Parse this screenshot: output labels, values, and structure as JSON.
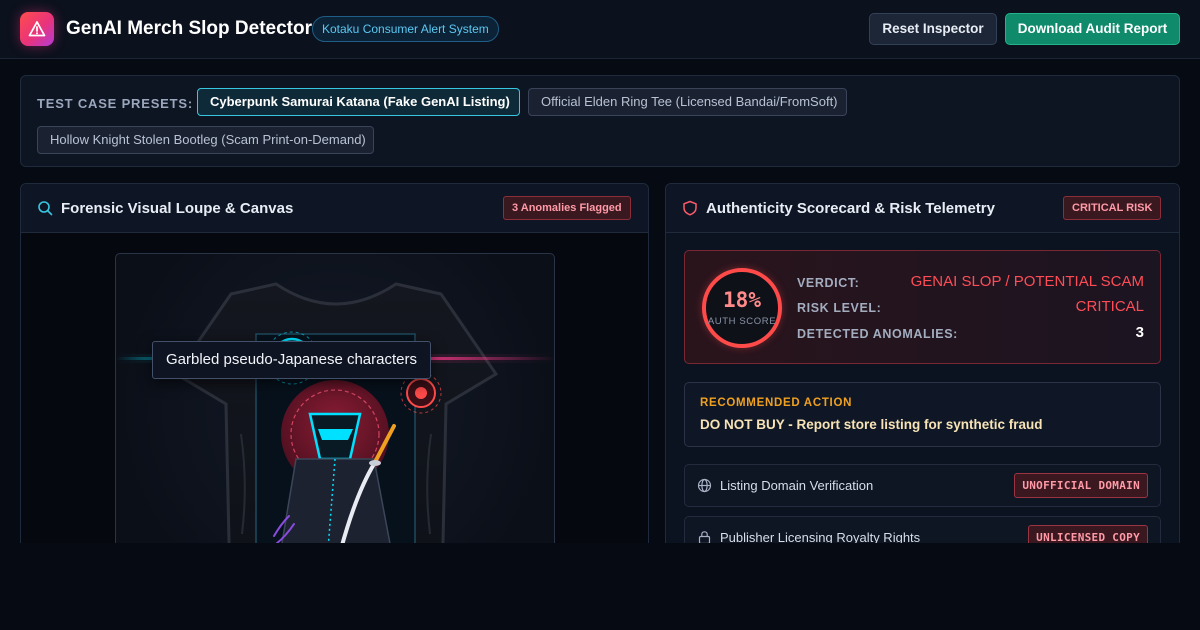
{
  "header": {
    "logo_icon": "warning-icon",
    "title": "GenAI Merch Slop Detector",
    "system_badge": "Kotaku Consumer Alert System",
    "reset_label": "Reset Inspector",
    "download_label": "Download Audit Report"
  },
  "presets": {
    "label": "TEST CASE PRESETS:",
    "items": [
      {
        "label": "Cyberpunk Samurai Katana (Fake GenAI Listing)",
        "active": true
      },
      {
        "label": "Official Elden Ring Tee (Licensed Bandai/FromSoft)",
        "active": false
      },
      {
        "label": "Hollow Knight Stolen Bootleg (Scam Print-on-Demand)",
        "active": false
      }
    ]
  },
  "loupe": {
    "icon": "search-icon",
    "title": "Forensic Visual Loupe & Canvas",
    "flag_badge": "3 Anomalies Flagged",
    "tooltip": "Garbled pseudo-Japanese characters"
  },
  "scorecard": {
    "icon": "shield-icon",
    "title": "Authenticity Scorecard & Risk Telemetry",
    "risk_badge": "CRITICAL RISK",
    "auth_score": "18%",
    "auth_score_label": "AUTH SCORE",
    "verdict_label": "VERDICT:",
    "verdict_value": "GENAI SLOP / POTENTIAL SCAM",
    "risk_level_label": "RISK LEVEL:",
    "risk_level_value": "CRITICAL",
    "anomalies_label": "DETECTED ANOMALIES:",
    "anomalies_value": "3"
  },
  "recommendation": {
    "label": "RECOMMENDED ACTION",
    "text": "DO NOT BUY - Report store listing for synthetic fraud"
  },
  "checks": [
    {
      "icon": "globe-icon",
      "label": "Listing Domain Verification",
      "status": "UNOFFICIAL DOMAIN"
    },
    {
      "icon": "lock-icon",
      "label": "Publisher Licensing Royalty Rights",
      "status": "UNLICENSED COPY"
    }
  ],
  "colors": {
    "accent_teal": "#0f8a6b",
    "accent_cyan": "#39c6e0",
    "critical_red": "#ff4d57",
    "warning_amber": "#f0a020"
  }
}
